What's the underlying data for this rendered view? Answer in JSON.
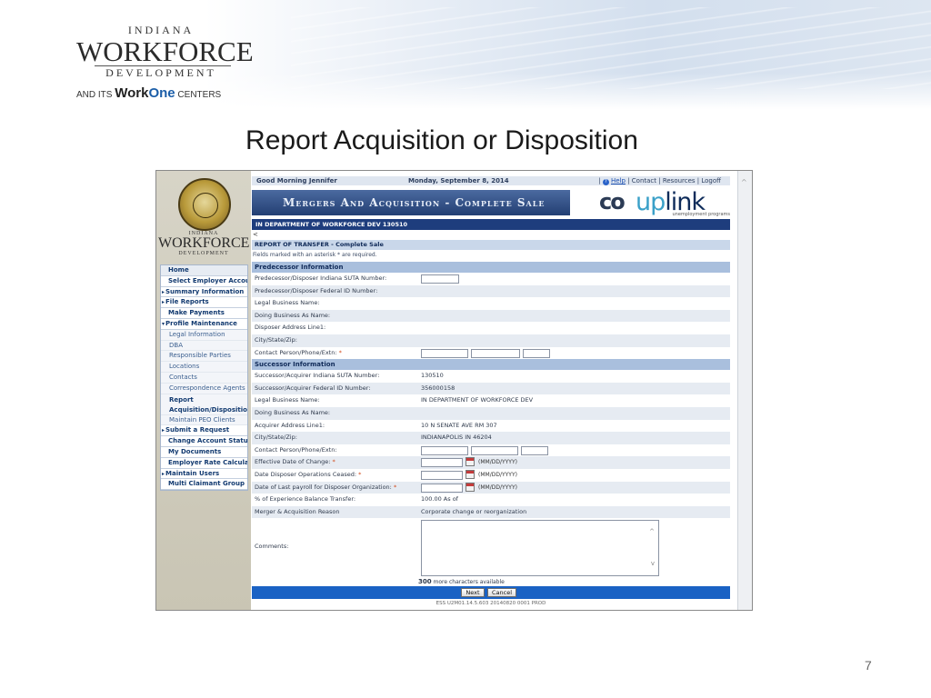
{
  "slide": {
    "title": "Report Acquisition or Disposition",
    "page_number": "7",
    "logo": {
      "top": "INDIANA",
      "main": "WORKFORCE",
      "sub": "DEVELOPMENT",
      "tag_prefix": "AND ITS ",
      "tag_work": "Work",
      "tag_one": "One",
      "tag_suffix": " CENTERS"
    }
  },
  "app": {
    "topbar": {
      "greeting": "Good Morning Jennifer",
      "date": "Monday, September 8, 2014",
      "help": "Help",
      "links": " | Contact | Resources | Logoff"
    },
    "banner": {
      "title": "Mergers And Acquisition - Complete Sale",
      "brand_co": "co",
      "brand_up": "up",
      "brand_link": "link",
      "brand_sub": "unemployment programs"
    },
    "nav_logo": {
      "top": "INDIANA",
      "main": "WORKFORCE",
      "sub": "DEVELOPMENT"
    },
    "menu": [
      {
        "label": "Home",
        "kind": "home"
      },
      {
        "label": "Select Employer Account",
        "kind": "bold"
      },
      {
        "label": "Summary Information",
        "kind": "arrow"
      },
      {
        "label": "File Reports",
        "kind": "arrow"
      },
      {
        "label": "Make Payments",
        "kind": "bold"
      },
      {
        "label": "Profile Maintenance",
        "kind": "open"
      },
      {
        "label": "Legal Information",
        "kind": "sub"
      },
      {
        "label": "DBA",
        "kind": "sub"
      },
      {
        "label": "Responsible Parties",
        "kind": "sub"
      },
      {
        "label": "Locations",
        "kind": "sub"
      },
      {
        "label": "Contacts",
        "kind": "sub"
      },
      {
        "label": "Correspondence Agents",
        "kind": "sub"
      },
      {
        "label": "Report Acquisition/Disposition",
        "kind": "current"
      },
      {
        "label": "Maintain PEO Clients",
        "kind": "sub"
      },
      {
        "label": "Submit a Request",
        "kind": "arrow"
      },
      {
        "label": "Change Account Status",
        "kind": "bold"
      },
      {
        "label": "My Documents",
        "kind": "bold"
      },
      {
        "label": "Employer Rate Calculator",
        "kind": "bold"
      },
      {
        "label": "Maintain Users",
        "kind": "arrow"
      },
      {
        "label": "Multi Claimant Group",
        "kind": "bold"
      }
    ],
    "dept_bar": "IN DEPARTMENT OF WORKFORCE DEV   130510",
    "back": "<",
    "report_title": "REPORT OF TRANSFER - Complete Sale",
    "required_note": "Fields marked with an asterisk * are required.",
    "predecessor": {
      "heading": "Predecessor Information",
      "suta_label": "Predecessor/Disposer Indiana SUTA Number:",
      "fein_label": "Predecessor/Disposer Federal ID Number:",
      "legal_label": "Legal Business Name:",
      "dba_label": "Doing Business As Name:",
      "addr_label": "Disposer Address Line1:",
      "city_label": "City/State/Zip:",
      "contact_label": "Contact Person/Phone/Extn:"
    },
    "successor": {
      "heading": "Successor Information",
      "suta_label": "Successor/Acquirer Indiana SUTA Number:",
      "suta_value": "130510",
      "fein_label": "Successor/Acquirer Federal ID Number:",
      "fein_value": "356000158",
      "legal_label": "Legal Business Name:",
      "legal_value": "IN DEPARTMENT OF WORKFORCE DEV",
      "dba_label": "Doing Business As Name:",
      "addr_label": "Acquirer Address Line1:",
      "addr_value": "10 N SENATE AVE RM 307",
      "city_label": "City/State/Zip:",
      "city_value": "INDIANAPOLIS  IN  46204",
      "contact_label": "Contact Person/Phone/Extn:",
      "eff_label": "Effective Date of Change:",
      "ceased_label": "Date Disposer Operations Ceased:",
      "payroll_label": "Date of Last payroll for Disposer Organization:",
      "date_format": "(MM/DD/YYYY)",
      "pct_label": "% of Experience Balance Transfer:",
      "pct_value": "100.00 As of",
      "reason_label": "Merger & Acquisition Reason",
      "reason_value": "Corporate change or reorganization",
      "comments_label": "Comments:",
      "chars_count": "300",
      "chars_text": " more characters available"
    },
    "buttons": {
      "next": "Next",
      "cancel": "Cancel"
    },
    "version": "ESS U2M01.14.5.603 20140820 0001 PROD"
  }
}
